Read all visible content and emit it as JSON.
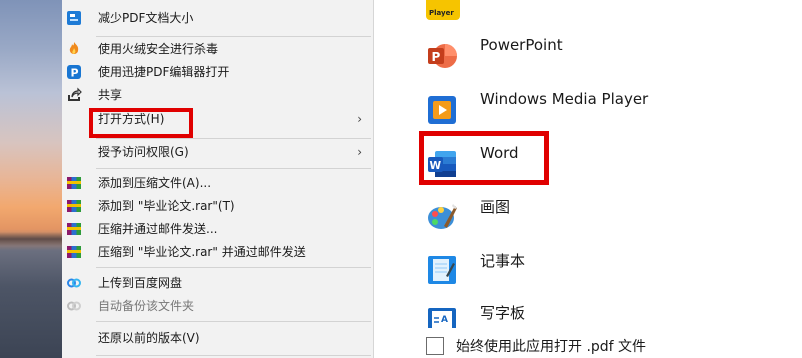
{
  "context_menu": {
    "items": [
      {
        "label": "减少PDF文档大小",
        "icon": "pdf-compress-icon"
      },
      {
        "label": "使用火绒安全进行杀毒",
        "icon": "huorong-shield-icon"
      },
      {
        "label": "使用迅捷PDF编辑器打开",
        "icon": "xunjie-pdf-icon"
      },
      {
        "label": "共享",
        "icon": "share-icon"
      },
      {
        "label": "打开方式(H)",
        "submenu_arrow": "›"
      },
      {
        "label": "授予访问权限(G)",
        "submenu_arrow": "›"
      },
      {
        "label": "添加到压缩文件(A)...",
        "icon": "winrar-icon"
      },
      {
        "label": "添加到 \"毕业论文.rar\"(T)",
        "icon": "winrar-icon"
      },
      {
        "label": "压缩并通过邮件发送...",
        "icon": "winrar-icon"
      },
      {
        "label": "压缩到 \"毕业论文.rar\" 并通过邮件发送",
        "icon": "winrar-icon"
      },
      {
        "label": "上传到百度网盘",
        "icon": "baidu-cloud-icon"
      },
      {
        "label": "自动备份该文件夹",
        "icon": "baidu-cloud-gray-icon"
      },
      {
        "label": "还原以前的版本(V)"
      }
    ],
    "highlight_color": "#e00000"
  },
  "app_chooser": {
    "apps": [
      {
        "name": "PowerPoint",
        "icon": "powerpoint-icon"
      },
      {
        "name": "Windows Media Player",
        "icon": "windows-media-player-icon"
      },
      {
        "name": "Word",
        "icon": "word-icon"
      },
      {
        "name": "画图",
        "icon": "paint-icon"
      },
      {
        "name": "记事本",
        "icon": "notepad-icon"
      },
      {
        "name": "写字板",
        "icon": "wordpad-icon"
      }
    ],
    "top_partial_icon_label": "Player",
    "always_use_label": "始终使用此应用打开 .pdf 文件",
    "always_use_checked": false
  }
}
